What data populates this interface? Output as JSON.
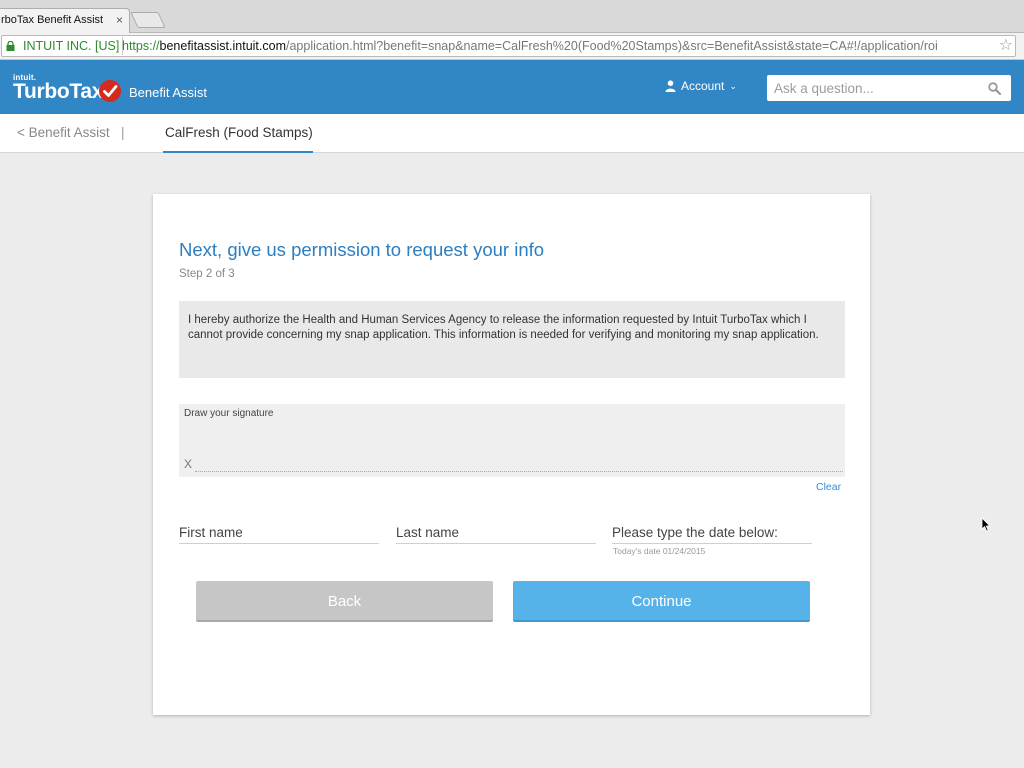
{
  "browser": {
    "tab_title": "rboTax Benefit Assist",
    "tab_close": "×",
    "ev_label": "INTUIT INC. [US]",
    "url_scheme": "https://",
    "url_host": "benefitassist.intuit.com",
    "url_path": "/application.html?benefit=snap&name=CalFresh%20(Food%20Stamps)&src=BenefitAssist&state=CA#!/application/roi"
  },
  "header": {
    "intuit_label": "intuit.",
    "brand": "TurboTax",
    "product": "Benefit Assist",
    "account_label": "Account",
    "search_placeholder": "Ask a question..."
  },
  "subnav": {
    "back_label": "< Benefit Assist",
    "separator": "|",
    "active_tab": "CalFresh (Food Stamps)"
  },
  "form": {
    "title": "Next, give us permission to request your info",
    "step": "Step 2 of 3",
    "authorization": "I hereby authorize the Health and Human Services Agency to release the information requested by Intuit TurboTax which I cannot provide concerning my snap application. This information is needed for verifying and monitoring my snap application.",
    "signature_label": "Draw your signature",
    "signature_x": "X",
    "clear_label": "Clear",
    "first_name_placeholder": "First name",
    "last_name_placeholder": "Last name",
    "date_placeholder": "Please type the date below:",
    "date_hint": "Today's date 01/24/2015",
    "back_button": "Back",
    "continue_button": "Continue"
  },
  "colors": {
    "header_blue": "#3186c5",
    "title_blue": "#2b7ec1",
    "continue_blue": "#56b3ea",
    "back_gray": "#c6c6c6",
    "turbotax_red": "#d52b1e"
  }
}
